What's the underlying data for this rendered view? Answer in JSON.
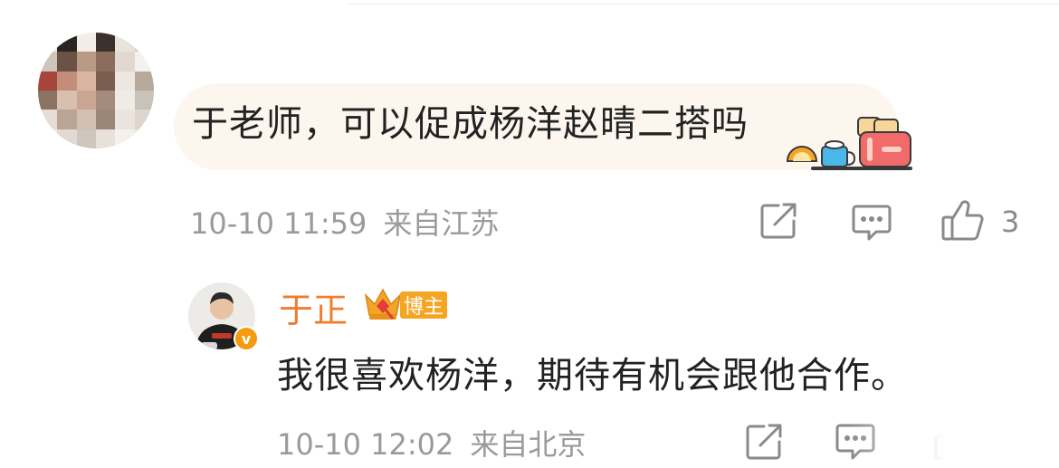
{
  "comments": [
    {
      "username": "",
      "text": "于老师，可以促成杨洋赵晴二搭吗",
      "time": "10-10 11:59",
      "location": "来自江苏",
      "likes": "3",
      "sticker": "breakfast-sticker-icon"
    },
    {
      "username": "于正",
      "badge": "博主",
      "verified": "v",
      "text": "我很喜欢杨洋，期待有机会跟他合作。",
      "time": "10-10 12:02",
      "location": "来自北京"
    }
  ],
  "icons": {
    "share": "share-icon",
    "comment": "comment-icon",
    "like": "like-icon",
    "crown": "crown-icon"
  },
  "colors": {
    "author_name": "#f07c2c",
    "badge": "#f4a623",
    "meta_text": "#9a9a9a",
    "bubble_bg": "#fdf6ee"
  }
}
